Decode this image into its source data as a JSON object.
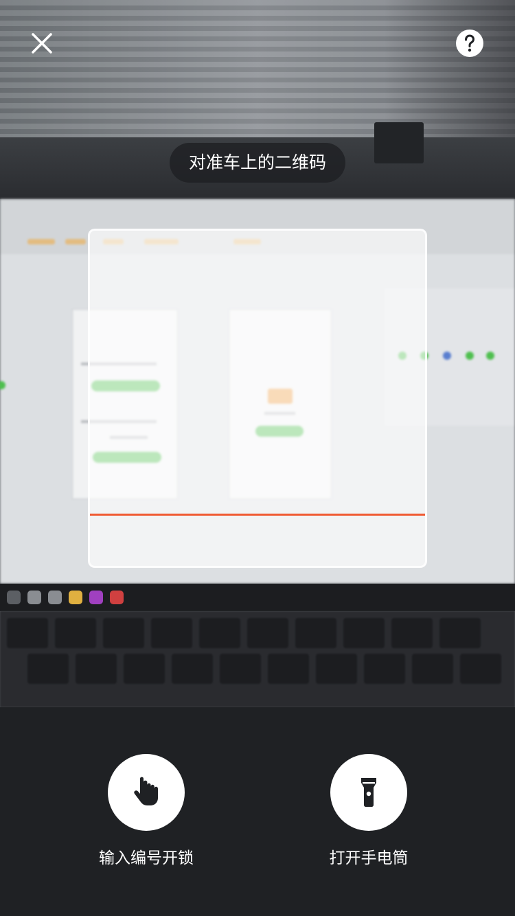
{
  "scanner": {
    "hint": "对准车上的二维码",
    "scan_line_color": "#f05a32"
  },
  "top_bar": {
    "close_icon": "close-icon",
    "help_icon": "help-icon"
  },
  "actions": [
    {
      "label": "输入编号开锁",
      "icon": "hand-tap-icon"
    },
    {
      "label": "打开手电筒",
      "icon": "flashlight-icon"
    }
  ],
  "colors": {
    "panel_background": "#1f2124",
    "button_background": "#ffffff",
    "text": "#ffffff"
  }
}
